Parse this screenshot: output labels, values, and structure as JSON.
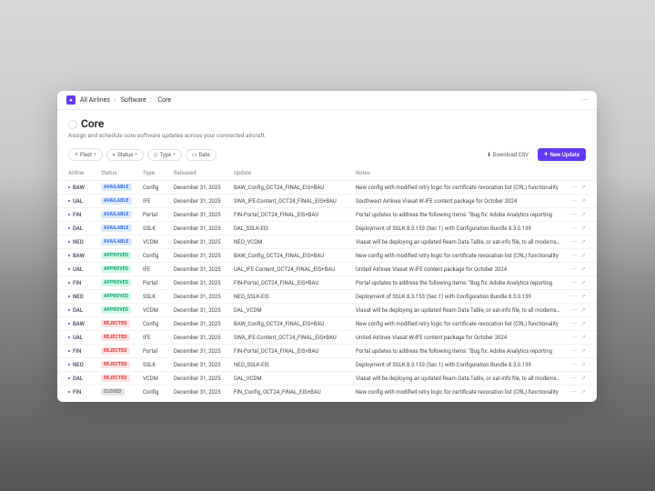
{
  "breadcrumb": {
    "org": "All Airlines",
    "section": "Software",
    "page": "Core"
  },
  "header": {
    "title": "Core",
    "subtitle": "Assign and schedule core software updates across your connected aircraft."
  },
  "filters": {
    "fleet": "Fleet",
    "status": "Status",
    "type": "Type",
    "date": "Date"
  },
  "actions": {
    "csv": "Download CSV",
    "newUpdate": "New Update"
  },
  "columns": {
    "airline": "Airline",
    "status": "Status",
    "type": "Type",
    "released": "Released",
    "update": "Update",
    "notes": "Notes"
  },
  "rows": [
    {
      "airline": "BAW",
      "status": "AVAILABLE",
      "type": "Config",
      "released": "December 31, 2025",
      "update": "BAW_Config_OCT24_FINAL_EIS+BAU",
      "notes": "New config with modified retry logic for certificate revocation list (CRL) functionality"
    },
    {
      "airline": "UAL",
      "status": "AVAILABLE",
      "type": "IFE",
      "released": "December 31, 2025",
      "update": "SWA_IFE-Content_OCT24_FINAL_EIS+BAU",
      "notes": "Southwest Airlines Viasat W-IFE content package for October 2024"
    },
    {
      "airline": "FIN",
      "status": "AVAILABLE",
      "type": "Portal",
      "released": "December 31, 2025",
      "update": "FIN-Portal_OCT24_FINAL_EIS+BAU",
      "notes": "Portal updates to address the following items: \"Bug fix: Adobe Analytics reporting"
    },
    {
      "airline": "DAL",
      "status": "AVAILABLE",
      "type": "SSLK",
      "released": "December 31, 2025",
      "update": "DAL_SSLK-EIS",
      "notes": "Deployment of SSLK 8.3.153 (Sec 1) with Configuration Bundle 8.3.0.139"
    },
    {
      "airline": "NEO",
      "status": "AVAILABLE",
      "type": "VCDM",
      "released": "December 31, 2025",
      "update": "NEO_VCDM",
      "notes": "Viasat will be deploying an updated Ream Data Table, or sat-info file, to all modems. T…"
    },
    {
      "airline": "BAW",
      "status": "APPROVED",
      "type": "Config",
      "released": "December 31, 2025",
      "update": "BAW_Config_OCT24_FINAL_EIS+BAU",
      "notes": "New config with modified retry logic for certificate revocation list (CRL) functionality"
    },
    {
      "airline": "UAL",
      "status": "APPROVED",
      "type": "IFE",
      "released": "December 31, 2025",
      "update": "UAL_IFE-Content_OCT24_FINAL_EIS+BAU",
      "notes": "United Airlines Viasat W-IFE content package for October 2024"
    },
    {
      "airline": "FIN",
      "status": "APPROVED",
      "type": "Portal",
      "released": "December 31, 2025",
      "update": "FIN-Portal_OCT24_FINAL_EIS+BAU",
      "notes": "Portal updates to address the following items: \"Bug fix: Adobe Analytics reporting"
    },
    {
      "airline": "NEO",
      "status": "APPROVED",
      "type": "SSLK",
      "released": "December 31, 2025",
      "update": "NEO_SSLK-EIS",
      "notes": "Deployment of SSLK 8.3.153 (Sec 1) with Configuration Bundle 8.3.0.139"
    },
    {
      "airline": "DAL",
      "status": "APPROVED",
      "type": "VCDM",
      "released": "December 31, 2025",
      "update": "DAL_VCDM",
      "notes": "Viasat will be deploying an updated Ream Data Table, or sat-info file, to all modems. T…"
    },
    {
      "airline": "BAW",
      "status": "REJECTED",
      "type": "Config",
      "released": "December 31, 2025",
      "update": "BAW_Config_OCT24_FINAL_EIS+BAU",
      "notes": "New config with modified retry logic for certificate revocation list (CRL) functionality"
    },
    {
      "airline": "UAL",
      "status": "REJECTED",
      "type": "IFE",
      "released": "December 31, 2025",
      "update": "SWA_IFE-Content_OCT24_FINAL_EIS+BAU",
      "notes": "United Airlines Viasat W-IFE content package for October 2024"
    },
    {
      "airline": "FIN",
      "status": "REJECTED",
      "type": "Portal",
      "released": "December 31, 2025",
      "update": "FIN-Portal_OCT24_FINAL_EIS+BAU",
      "notes": "Portal updates to address the following items: \"Bug fix: Adobe Analytics reporting"
    },
    {
      "airline": "NEO",
      "status": "REJECTED",
      "type": "SSLK",
      "released": "December 31, 2025",
      "update": "NEO_SSLK-EIS",
      "notes": "Deployment of SSLK 8.3.153 (Sec 1) with Configuration Bundle 8.3.0.139"
    },
    {
      "airline": "DAL",
      "status": "REJECTED",
      "type": "VCDM",
      "released": "December 31, 2025",
      "update": "DAL_VCDM",
      "notes": "Viasat will be deploying an updated Ream Data Table, or sat-info file, to all modems. T…"
    },
    {
      "airline": "FIN",
      "status": "CLOSED",
      "type": "Config",
      "released": "December 31, 2025",
      "update": "FIN_Config_OCT24_FINAL_EIS+BAU",
      "notes": "New config with modified retry logic for certificate revocation list (CRL) functionality"
    }
  ]
}
